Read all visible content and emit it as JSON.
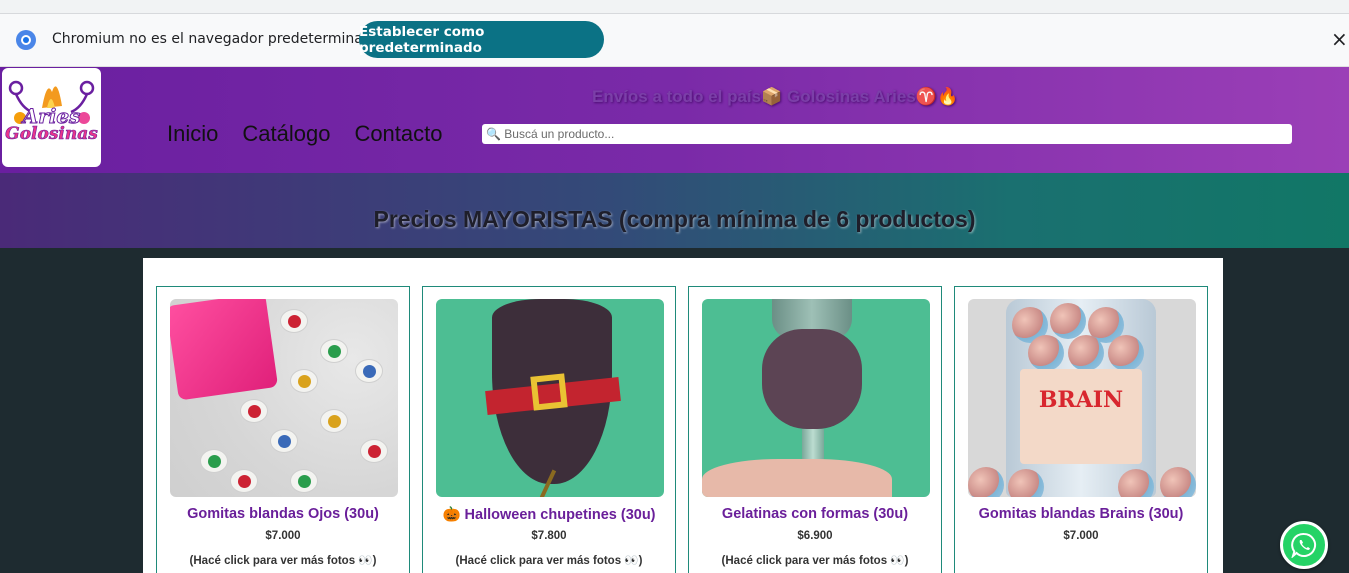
{
  "infobar": {
    "message": "Chromium no es el navegador predeterminado",
    "set_default_label": "Establecer como predeterminado",
    "close_glyph": "×"
  },
  "header": {
    "logo_line1": "Aries",
    "logo_line2": "Golosinas",
    "nav": [
      {
        "label": "Inicio"
      },
      {
        "label": "Catálogo"
      },
      {
        "label": "Contacto"
      }
    ],
    "promo": "Envíos a todo el país📦 Golosinas Aries♈🔥",
    "search_placeholder": "🔍 Buscá un producto..."
  },
  "banner": {
    "title": "Precios MAYORISTAS (compra mínima de 6 productos)"
  },
  "products": [
    {
      "title": "Gomitas blandas Ojos (30u)",
      "price": "$7.000",
      "more": "(Hacé click para ver más fotos 👀)"
    },
    {
      "title": "🎃 Halloween chupetines (30u)",
      "price": "$7.800",
      "more": "(Hacé click para ver más fotos 👀)"
    },
    {
      "title": "Gelatinas con formas (30u)",
      "price": "$6.900",
      "more": "(Hacé click para ver más fotos 👀)"
    },
    {
      "title": "Gomitas blandas Brains (30u)",
      "price": "$7.000",
      "more": ""
    }
  ],
  "images": {
    "brains_label": "BRAIN"
  },
  "colors": {
    "accent": "#0b7285",
    "header_purple": "#7a2aa8",
    "title_purple": "#6a1f9a",
    "card_border": "#1f8a7a",
    "whatsapp": "#25d366"
  },
  "icons": {
    "browser": "chromium-icon",
    "close": "close-icon",
    "whatsapp": "whatsapp-icon"
  }
}
